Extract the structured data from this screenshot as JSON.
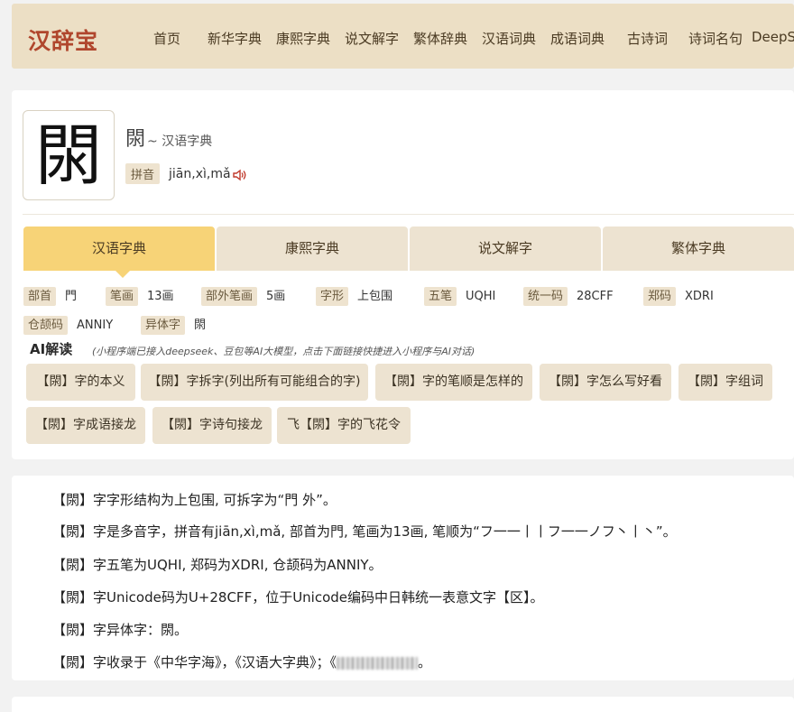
{
  "header": {
    "logo": "汉辞宝",
    "nav": [
      "首页",
      "新华字典",
      "康熙字典",
      "说文解字",
      "繁体辞典",
      "汉语词典",
      "成语词典",
      "古诗词",
      "诗词名句",
      "DeepS"
    ]
  },
  "entry": {
    "character": "閖",
    "title_suffix": "~ 汉语字典",
    "pinyin_label": "拼音",
    "pinyin": "jiān,xì,mǎ",
    "speaker_icon": "speaker-icon"
  },
  "tabs": [
    "汉语字典",
    "康熙字典",
    "说文解字",
    "繁体字典"
  ],
  "active_tab": 0,
  "attributes": [
    {
      "label": "部首",
      "value": "門"
    },
    {
      "label": "笔画",
      "value": "13画"
    },
    {
      "label": "部外笔画",
      "value": "5画"
    },
    {
      "label": "字形",
      "value": "上包围"
    },
    {
      "label": "五笔",
      "value": "UQHI"
    },
    {
      "label": "统一码",
      "value": "28CFF"
    },
    {
      "label": "郑码",
      "value": "XDRI"
    },
    {
      "label": "仓颉码",
      "value": "ANNIY"
    },
    {
      "label": "异体字",
      "value": "閖"
    }
  ],
  "ai": {
    "title": "AI解读",
    "note": "(小程序端已接入deepseek、豆包等AI大模型，点击下面链接快捷进入小程序与AI对话)",
    "buttons": [
      "【閖】字的本义",
      "【閖】字拆字(列出所有可能组合的字)",
      "【閖】字的笔顺是怎样的",
      "【閖】字怎么写好看",
      "【閖】字组词",
      "【閖】字成语接龙",
      "【閖】字诗句接龙",
      "飞【閖】字的飞花令"
    ]
  },
  "description": [
    "【閖】字字形结构为上包围, 可拆字为“門 外”。",
    "【閖】字是多音字，拼音有jiān,xì,mǎ, 部首为門, 笔画为13画, 笔顺为“フ一一丨丨フ一一ノフ丶丨丶”。",
    "【閖】字五笔为UQHI, 郑码为XDRI, 仓颉码为ANNIY。",
    "【閖】字Unicode码为U+28CFF，位于Unicode编码中日韩统一表意文字【区】。",
    "【閖】字异体字：閖。",
    "【閖】字收录于《中华字海》，《汉语大字典》；《"
  ],
  "description_tail": "。",
  "colors": {
    "header_bg": "#ecdfc5",
    "logo": "#b0462d",
    "tab_active": "#f7d377",
    "tag_bg": "#eee3cf",
    "speaker": "#c0392b"
  }
}
